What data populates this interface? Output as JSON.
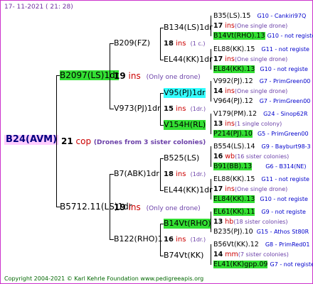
{
  "header": "17- 11-2021 ( 21: 28)",
  "root": {
    "label": "B24(AVM)",
    "num": "21",
    "unit": "cop",
    "note": "(Drones from 3 sister colonies)"
  },
  "g1": [
    {
      "label": "B2097(LS)1dr",
      "num": "19",
      "unit": "ins",
      "note": "(Only one drone)"
    },
    {
      "label": "B5712.11(LS)1dr",
      "num": "19",
      "unit": "ins",
      "note": "(Only one drone)"
    }
  ],
  "g2": [
    {
      "label": "B209(FZ)",
      "num": "18",
      "unit": "ins",
      "note": "(1 c.)"
    },
    {
      "label": "V973(PJ)1dr",
      "num": "15",
      "unit": "ins",
      "note": "(1dr.)"
    },
    {
      "label": "B7(ABK)1dr",
      "num": "18",
      "unit": "ins",
      "note": "(1dr.)"
    },
    {
      "label": "B122(RHO)1",
      "num": "16",
      "unit": "ins",
      "note": "(1dr.)"
    }
  ],
  "g3": [
    {
      "label": "B134(LS)1dr"
    },
    {
      "label": "EL44(KK)1dr"
    },
    {
      "label": "V95(PJ)1dr"
    },
    {
      "label": "V154H(RL)"
    },
    {
      "label": "B525(LS)"
    },
    {
      "label": "EL44(KK)1dr"
    },
    {
      "label": "B14Vt(RHO)"
    },
    {
      "label": "B74Vt(KK)"
    }
  ],
  "g4": [
    {
      "top": "B35(LS).15",
      "topnote": "G10 - Cankiri97Q",
      "num": "17",
      "unit": "ins",
      "note": "(One single drone)",
      "bottom": "B14Vt(RHO).13",
      "bottomnote": "G10 - not registe"
    },
    {
      "top": "EL88(KK).15",
      "topnote": "G11 - not registe",
      "num": "17",
      "unit": "ins",
      "note": "(One single drone)",
      "bottom": "EL84(KK).13",
      "bottomnote": "G10 - not registe"
    },
    {
      "top": "V992(PJ).12",
      "topnote": "G7 - PrimGreen00",
      "num": "14",
      "unit": "ins",
      "note": "(One single drone)",
      "bottom": "V964(PJ).12",
      "bottomnote": "G7 - PrimGreen00"
    },
    {
      "top": "V179(PM).12",
      "topnote": "G24 - Sinop62R",
      "num": "13",
      "unit": "ins",
      "note": "(1 single colony)",
      "bottom": "P214(PJ).10",
      "bottomnote": "G5 - PrimGreen00"
    },
    {
      "top": "B554(LS).14",
      "topnote": "G9 - Bayburt98-3",
      "num": "16",
      "unit": "wb",
      "note": "(16 sister colonies)",
      "bottom": "B91(BB).13",
      "bottomnote": "G6 - B314(NE)"
    },
    {
      "top": "EL88(KK).15",
      "topnote": "G11 - not registe",
      "num": "17",
      "unit": "ins",
      "note": "(One single drone)",
      "bottom": "EL84(KK).13",
      "bottomnote": "G10 - not registe"
    },
    {
      "top": "EL61(KK).11",
      "topnote": "G9 - not registe",
      "num": "13",
      "unit": "hb",
      "note": "(18 sister colonies)",
      "bottom": "B235(PJ).10",
      "bottomnote": "G15 - Athos St80R"
    },
    {
      "top": "B56Vt(KK).12",
      "topnote": "G8 - PrimRed01",
      "num": "14",
      "unit": "mm",
      "note": "(7 sister colonies)",
      "bottom": "EL41(KK)gpp.09",
      "bottomnote": "G7 - not registe"
    }
  ],
  "footer": "Copyright 2004-2021 © Karl Kehrle Foundation   www.pedigreeapis.org"
}
